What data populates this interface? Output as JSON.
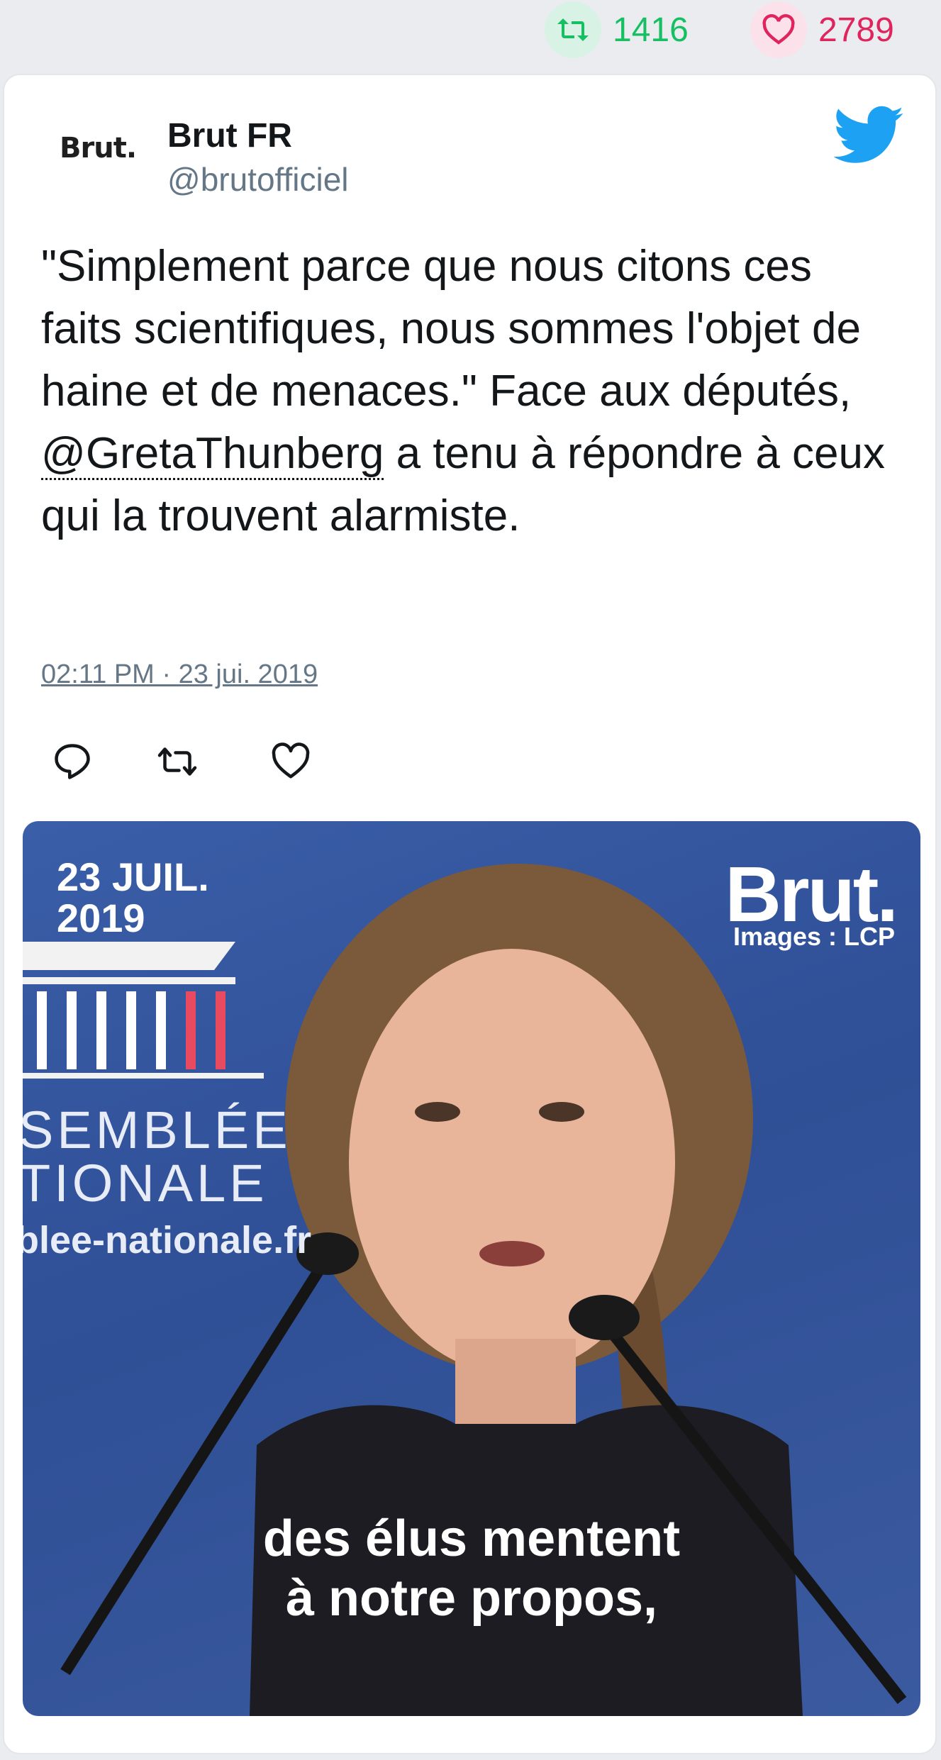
{
  "stats": {
    "retweets": "1416",
    "likes": "2789"
  },
  "tweet": {
    "logo_text": "Brut.",
    "author_name": "Brut FR",
    "author_handle": "@brutofficiel",
    "text_part1": "\"Simplement parce que nous citons ces faits scientifiques, nous sommes l'objet de haine et de menaces.\" Face aux députés, ",
    "mention": "@GretaThunberg",
    "text_part2": " a tenu à répondre à ceux qui la trouvent alarmiste.",
    "timestamp": "02:11 PM · 23 jui. 2019"
  },
  "media": {
    "date_line1": "23 JUIL.",
    "date_line2": "2019",
    "brand": "Brut.",
    "credit": "Images : LCP",
    "bg_line1": "SEMBLÉE",
    "bg_line2": "TIONALE",
    "bg_url": "blee-nationale.fr",
    "caption_line1": "des élus mentent",
    "caption_line2": "à notre propos,"
  },
  "colors": {
    "retweet_green": "#17bf63",
    "like_red": "#e0245e",
    "twitter_blue": "#1da1f2",
    "text_primary": "#14171a",
    "text_secondary": "#657786"
  },
  "icons": [
    "retweet-icon",
    "heart-icon",
    "twitter-bird-icon",
    "reply-icon",
    "retweet-action-icon",
    "like-action-icon"
  ]
}
